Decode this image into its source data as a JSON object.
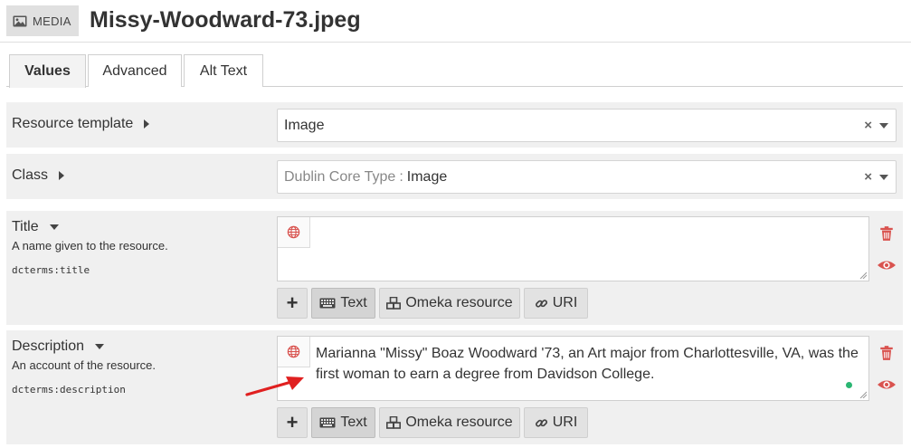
{
  "header": {
    "badge_label": "MEDIA",
    "badge_icon": "image-icon",
    "title": "Missy-Woodward-73.jpeg"
  },
  "tabs": [
    {
      "label": "Values",
      "active": true
    },
    {
      "label": "Advanced",
      "active": false
    },
    {
      "label": "Alt Text",
      "active": false
    }
  ],
  "resource_template": {
    "label": "Resource template",
    "value": "Image"
  },
  "class_field": {
    "label": "Class",
    "prefix": "Dublin Core Type",
    "separator": ":",
    "value": "Image"
  },
  "properties": [
    {
      "label": "Title",
      "description": "A name given to the resource.",
      "term": "dcterms:title",
      "value": ""
    },
    {
      "label": "Description",
      "description": "An account of the resource.",
      "term": "dcterms:description",
      "value": "Marianna \"Missy\" Boaz Woodward '73, an Art major from Charlottesville, VA, was the first woman to earn a degree from Davidson College."
    }
  ],
  "value_buttons": {
    "add": "+",
    "text": "Text",
    "omeka": "Omeka resource",
    "uri": "URI"
  },
  "colors": {
    "accent_red": "#d9534f",
    "status_green": "#2bb673",
    "row_bg": "#f0f0f0"
  }
}
